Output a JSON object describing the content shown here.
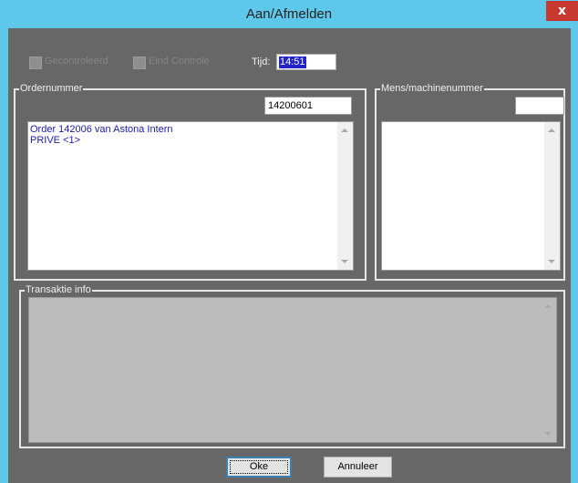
{
  "window": {
    "title": "Aan/Afmelden",
    "close_label": "x"
  },
  "checkboxes": [
    {
      "label": "Gecontroleerd",
      "checked": false,
      "enabled": false
    },
    {
      "label": "Eind Controle",
      "checked": false,
      "enabled": false
    }
  ],
  "tijd": {
    "label": "Tijd:",
    "value": "14:51"
  },
  "ordernummer": {
    "group_label": "Ordernummer",
    "value": "14200601",
    "list_lines": [
      "Order 142006 van Astona Intern",
      "PRIVE <1>"
    ]
  },
  "mens": {
    "group_label": "Mens/machinenummer",
    "value": ""
  },
  "transaktie": {
    "group_label": "Transaktie info"
  },
  "buttons": {
    "ok_label": "Oke",
    "cancel_label": "Annuleer"
  },
  "colors": {
    "titlebar": "#5ec8ea",
    "client": "#676767",
    "close": "#c7382f",
    "list_text": "#1a1ab4"
  }
}
